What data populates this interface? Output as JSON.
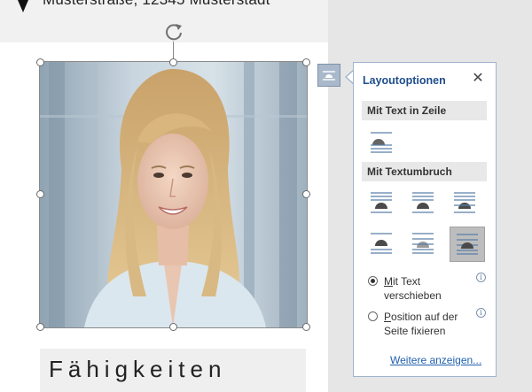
{
  "document": {
    "header_line": "Musterstraße, 12345 Musterstadt",
    "skills_heading": "Fähigkeiten"
  },
  "image": {
    "alt": "Bewerbungsfoto"
  },
  "layout_panel": {
    "title": "Layoutoptionen",
    "close_label": "✕",
    "section_inline": "Mit Text in Zeile",
    "section_wrap": "Mit Textumbruch",
    "wrap_options": [
      "square",
      "tight",
      "through",
      "top-bottom",
      "behind-text",
      "in-front-of-text"
    ],
    "selected_wrap_option": "in-front-of-text",
    "radio_move": {
      "label_underlined": "M",
      "label_rest_line1": "it Text",
      "label_line2": "verschieben",
      "checked": true
    },
    "radio_fix": {
      "label_underlined": "P",
      "label_rest_line1": "osition auf der",
      "label_line2": "Seite fixieren",
      "checked": false
    },
    "more_link": "Weitere anzeigen..."
  },
  "colors": {
    "accent": "#1f4e8c",
    "link": "#1f5fae",
    "selection_handle_border": "#6b6b6b"
  }
}
